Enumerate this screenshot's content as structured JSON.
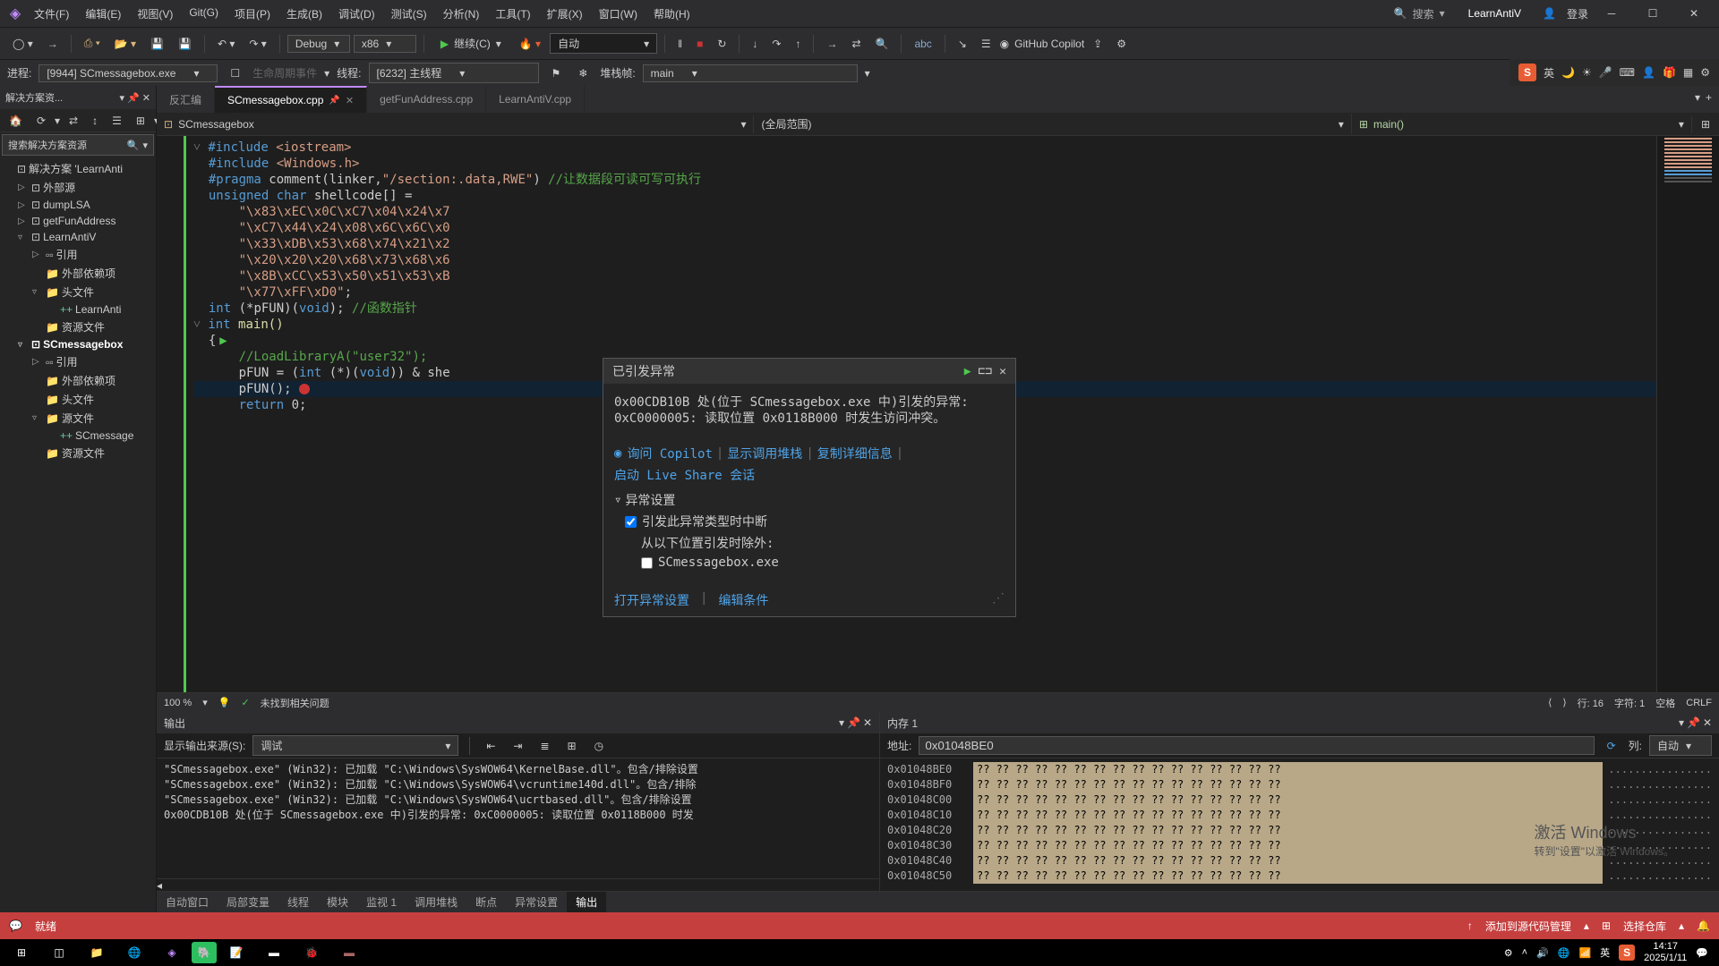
{
  "title_bar": {
    "project": "LearnAntiV",
    "search_label": "搜索",
    "search_placeholder": "搜索",
    "login": "登录",
    "menus": [
      "文件(F)",
      "编辑(E)",
      "视图(V)",
      "Git(G)",
      "项目(P)",
      "生成(B)",
      "调试(D)",
      "测试(S)",
      "分析(N)",
      "工具(T)",
      "扩展(X)",
      "窗口(W)",
      "帮助(H)"
    ]
  },
  "toolbar": {
    "config": "Debug",
    "platform": "x86",
    "continue_label": "继续(C)",
    "auto_label": "自动",
    "copilot_label": "GitHub Copilot"
  },
  "debug_bar": {
    "process_label": "进程:",
    "process_value": "[9944] SCmessagebox.exe",
    "lifecycle": "生命周期事件",
    "thread_label": "线程:",
    "thread_value": "[6232] 主线程",
    "stack_label": "堆栈帧:",
    "stack_value": "main"
  },
  "clock_widget": {
    "ch": "英"
  },
  "solution": {
    "title": "解决方案资...",
    "search_placeholder": "搜索解决方案资源",
    "sln": "解决方案 'LearnAnti",
    "items": {
      "external": "外部源",
      "dumpLSA": "dumpLSA",
      "getFunAddress": "getFunAddress",
      "LearnAntiV": "LearnAntiV",
      "refs": "引用",
      "extdeps": "外部依赖项",
      "headers": "头文件",
      "LearnAnti_h": "LearnAnti",
      "resources": "资源文件",
      "SCmessagebox": "SCmessagebox",
      "srcfiles": "源文件",
      "SCmessage_cpp": "SCmessage"
    }
  },
  "tabs": {
    "t0": "反汇编",
    "t1": "SCmessagebox.cpp",
    "t2": "getFunAddress.cpp",
    "t3": "LearnAntiV.cpp"
  },
  "navbar": {
    "scope": "SCmessagebox",
    "global": "(全局范围)",
    "func": "main()"
  },
  "code": {
    "l1a": "#include ",
    "l1b": "<iostream>",
    "l2a": "#include ",
    "l2b": "<Windows.h>",
    "l3a": "#pragma",
    "l3b": " comment(linker,",
    "l3c": "\"/section:.data,RWE\"",
    "l3d": ")  ",
    "l3e": "//让数据段可读可写可执行",
    "l4a": "unsigned char",
    "l4b": " shellcode[] =",
    "l5": "\"\\x83\\xEC\\x0C\\xC7\\x04\\x24\\x7",
    "l6": "\"\\xC7\\x44\\x24\\x08\\x6C\\x6C\\x0",
    "l7": "\"\\x33\\xDB\\x53\\x68\\x74\\x21\\x2",
    "l8": "\"\\x20\\x20\\x20\\x68\\x73\\x68\\x6",
    "l9": "\"\\x8B\\xCC\\x53\\x50\\x51\\x53\\xB",
    "l10": "\"\\x77\\xFF\\xD0\"",
    "l11a": "int",
    "l11b": " (*pFUN)(",
    "l11c": "void",
    "l11d": ");  ",
    "l11e": "//函数指针",
    "l12a": "int",
    "l12b": " main()",
    "l13": "{",
    "l14": "//LoadLibraryA(\"user32\");",
    "l15a": "pFUN = (",
    "l15b": "int",
    "l15c": " (*)(",
    "l15d": "void",
    "l15e": ")) & she",
    "l16": "pFUN();",
    "l17a": "return",
    "l17b": " 0;"
  },
  "exception": {
    "title": "已引发异常",
    "msg1": "0x00CDB10B 处(位于 SCmessagebox.exe 中)引发的异常:",
    "msg2": "0xC0000005: 读取位置 0x0118B000 时发生访问冲突。",
    "ask_copilot": "询问 Copilot",
    "show_stack": "显示调用堆栈",
    "copy_details": "复制详细信息",
    "start_liveshare": "启动 Live Share 会话",
    "settings_label": "异常设置",
    "break_check": "引发此异常类型时中断",
    "except_label": "从以下位置引发时除外:",
    "except_item": "SCmessagebox.exe",
    "open_settings": "打开异常设置",
    "edit_cond": "编辑条件"
  },
  "code_status": {
    "zoom": "100 %",
    "no_issues": "未找到相关问题",
    "line": "行: 16",
    "col": "字符: 1",
    "spaces": "空格",
    "crlf": "CRLF"
  },
  "output": {
    "title": "输出",
    "source_label": "显示输出来源(S):",
    "source_value": "调试",
    "lines": [
      "\"SCmessagebox.exe\" (Win32): 已加载 \"C:\\Windows\\SysWOW64\\KernelBase.dll\"。包含/排除设置",
      "\"SCmessagebox.exe\" (Win32): 已加载 \"C:\\Windows\\SysWOW64\\vcruntime140d.dll\"。包含/排除",
      "\"SCmessagebox.exe\" (Win32): 已加载 \"C:\\Windows\\SysWOW64\\ucrtbased.dll\"。包含/排除设置",
      "0x00CDB10B 处(位于 SCmessagebox.exe 中)引发的异常: 0xC0000005: 读取位置 0x0118B000 时发"
    ]
  },
  "memory": {
    "title": "内存 1",
    "addr_label": "地址:",
    "addr_value": "0x01048BE0",
    "col_label": "列:",
    "col_value": "自动",
    "rows": [
      {
        "a": "0x01048BE0",
        "b": "?? ?? ?? ?? ?? ?? ?? ?? ?? ?? ?? ?? ?? ?? ?? ??",
        "c": "................"
      },
      {
        "a": "0x01048BF0",
        "b": "?? ?? ?? ?? ?? ?? ?? ?? ?? ?? ?? ?? ?? ?? ?? ??",
        "c": "................"
      },
      {
        "a": "0x01048C00",
        "b": "?? ?? ?? ?? ?? ?? ?? ?? ?? ?? ?? ?? ?? ?? ?? ??",
        "c": "................"
      },
      {
        "a": "0x01048C10",
        "b": "?? ?? ?? ?? ?? ?? ?? ?? ?? ?? ?? ?? ?? ?? ?? ??",
        "c": "................"
      },
      {
        "a": "0x01048C20",
        "b": "?? ?? ?? ?? ?? ?? ?? ?? ?? ?? ?? ?? ?? ?? ?? ??",
        "c": "................"
      },
      {
        "a": "0x01048C30",
        "b": "?? ?? ?? ?? ?? ?? ?? ?? ?? ?? ?? ?? ?? ?? ?? ??",
        "c": "................"
      },
      {
        "a": "0x01048C40",
        "b": "?? ?? ?? ?? ?? ?? ?? ?? ?? ?? ?? ?? ?? ?? ?? ??",
        "c": "................"
      },
      {
        "a": "0x01048C50",
        "b": "?? ?? ?? ?? ?? ?? ?? ?? ?? ?? ?? ?? ?? ?? ?? ??",
        "c": "................"
      }
    ]
  },
  "bottom_tabs": [
    "自动窗口",
    "局部变量",
    "线程",
    "模块",
    "监视 1",
    "调用堆栈",
    "断点",
    "异常设置",
    "输出"
  ],
  "bottom_tabs_active": 8,
  "status": {
    "ready": "就绪",
    "add_scm": "添加到源代码管理",
    "select_repo": "选择仓库"
  },
  "taskbar": {
    "ime": "英",
    "time": "14:17",
    "date": "2025/1/11"
  },
  "watermark": {
    "l1": "激活 Windows",
    "l2": "转到\"设置\"以激活 Windows。"
  }
}
